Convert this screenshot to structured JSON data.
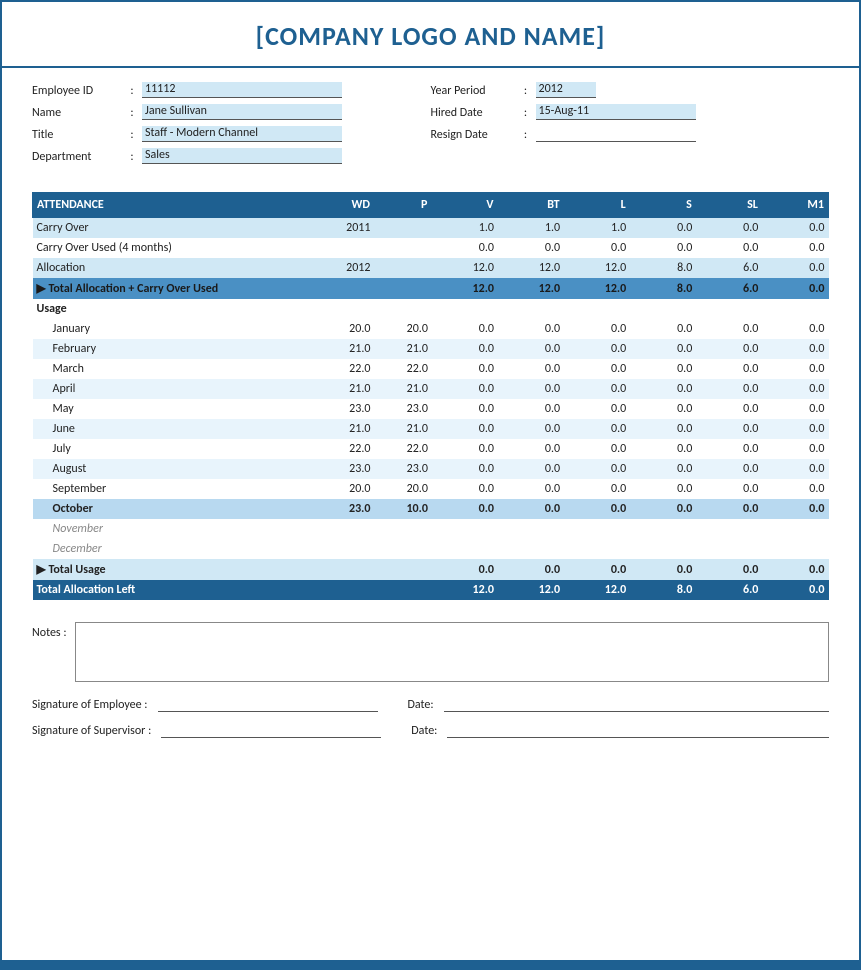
{
  "header": {
    "title": "[COMPANY LOGO AND NAME]"
  },
  "employee": {
    "id_label": "Employee ID",
    "id_colon": ":",
    "id_value": "11112",
    "name_label": "Name",
    "name_colon": ":",
    "name_value": "Jane Sullivan",
    "title_label": "Title",
    "title_colon": ":",
    "title_value": "Staff - Modern Channel",
    "dept_label": "Department",
    "dept_colon": ":",
    "dept_value": "Sales"
  },
  "period": {
    "year_label": "Year Period",
    "year_colon": ":",
    "year_value": "2012",
    "hired_label": "Hired Date",
    "hired_colon": ":",
    "hired_value": "15-Aug-11",
    "resign_label": "Resign Date",
    "resign_colon": ":"
  },
  "table": {
    "headers": [
      "ATTENDANCE",
      "WD",
      "P",
      "V",
      "BT",
      "L",
      "S",
      "SL",
      "M1"
    ],
    "rows": [
      {
        "type": "carry-over",
        "label": "Carry Over",
        "year": "2011",
        "wd": "",
        "p": "",
        "v": "1.0",
        "bt": "1.0",
        "l": "1.0",
        "s": "0.0",
        "sl": "0.0",
        "m1": "0.0"
      },
      {
        "type": "carry-over-used",
        "label": "Carry Over Used (4 months)",
        "year": "",
        "wd": "",
        "p": "",
        "v": "0.0",
        "bt": "0.0",
        "l": "0.0",
        "s": "0.0",
        "sl": "0.0",
        "m1": "0.0"
      },
      {
        "type": "allocation",
        "label": "Allocation",
        "year": "2012",
        "wd": "",
        "p": "",
        "v": "12.0",
        "bt": "12.0",
        "l": "12.0",
        "s": "8.0",
        "sl": "6.0",
        "m1": "0.0"
      },
      {
        "type": "total-alloc",
        "label": "▶ Total Allocation + Carry Over Used",
        "year": "",
        "wd": "",
        "p": "",
        "v": "12.0",
        "bt": "12.0",
        "l": "12.0",
        "s": "8.0",
        "sl": "6.0",
        "m1": "0.0"
      },
      {
        "type": "usage-header",
        "label": "Usage",
        "year": "",
        "wd": "",
        "p": "",
        "v": "",
        "bt": "",
        "l": "",
        "s": "",
        "sl": "",
        "m1": ""
      },
      {
        "type": "month-odd",
        "label": "January",
        "year": "",
        "wd": "20.0",
        "p": "20.0",
        "v": "0.0",
        "bt": "0.0",
        "l": "0.0",
        "s": "0.0",
        "sl": "0.0",
        "m1": "0.0"
      },
      {
        "type": "month-even",
        "label": "February",
        "year": "",
        "wd": "21.0",
        "p": "21.0",
        "v": "0.0",
        "bt": "0.0",
        "l": "0.0",
        "s": "0.0",
        "sl": "0.0",
        "m1": "0.0"
      },
      {
        "type": "month-odd",
        "label": "March",
        "year": "",
        "wd": "22.0",
        "p": "22.0",
        "v": "0.0",
        "bt": "0.0",
        "l": "0.0",
        "s": "0.0",
        "sl": "0.0",
        "m1": "0.0"
      },
      {
        "type": "month-even",
        "label": "April",
        "year": "",
        "wd": "21.0",
        "p": "21.0",
        "v": "0.0",
        "bt": "0.0",
        "l": "0.0",
        "s": "0.0",
        "sl": "0.0",
        "m1": "0.0"
      },
      {
        "type": "month-odd",
        "label": "May",
        "year": "",
        "wd": "23.0",
        "p": "23.0",
        "v": "0.0",
        "bt": "0.0",
        "l": "0.0",
        "s": "0.0",
        "sl": "0.0",
        "m1": "0.0"
      },
      {
        "type": "month-even",
        "label": "June",
        "year": "",
        "wd": "21.0",
        "p": "21.0",
        "v": "0.0",
        "bt": "0.0",
        "l": "0.0",
        "s": "0.0",
        "sl": "0.0",
        "m1": "0.0"
      },
      {
        "type": "month-odd",
        "label": "July",
        "year": "",
        "wd": "22.0",
        "p": "22.0",
        "v": "0.0",
        "bt": "0.0",
        "l": "0.0",
        "s": "0.0",
        "sl": "0.0",
        "m1": "0.0"
      },
      {
        "type": "month-even",
        "label": "August",
        "year": "",
        "wd": "23.0",
        "p": "23.0",
        "v": "0.0",
        "bt": "0.0",
        "l": "0.0",
        "s": "0.0",
        "sl": "0.0",
        "m1": "0.0"
      },
      {
        "type": "month-odd",
        "label": "September",
        "year": "",
        "wd": "20.0",
        "p": "20.0",
        "v": "0.0",
        "bt": "0.0",
        "l": "0.0",
        "s": "0.0",
        "sl": "0.0",
        "m1": "0.0"
      },
      {
        "type": "october",
        "label": "October",
        "year": "",
        "wd": "23.0",
        "p": "10.0",
        "v": "0.0",
        "bt": "0.0",
        "l": "0.0",
        "s": "0.0",
        "sl": "0.0",
        "m1": "0.0"
      },
      {
        "type": "future",
        "label": "November",
        "year": "",
        "wd": "",
        "p": "",
        "v": "",
        "bt": "",
        "l": "",
        "s": "",
        "sl": "",
        "m1": ""
      },
      {
        "type": "future",
        "label": "December",
        "year": "",
        "wd": "",
        "p": "",
        "v": "",
        "bt": "",
        "l": "",
        "s": "",
        "sl": "",
        "m1": ""
      },
      {
        "type": "total-usage",
        "label": "▶ Total Usage",
        "year": "",
        "wd": "",
        "p": "",
        "v": "0.0",
        "bt": "0.0",
        "l": "0.0",
        "s": "0.0",
        "sl": "0.0",
        "m1": "0.0"
      },
      {
        "type": "alloc-left",
        "label": "Total Allocation Left",
        "year": "",
        "wd": "",
        "p": "",
        "v": "12.0",
        "bt": "12.0",
        "l": "12.0",
        "s": "8.0",
        "sl": "6.0",
        "m1": "0.0"
      }
    ]
  },
  "notes": {
    "label": "Notes :"
  },
  "signatures": {
    "emp_label": "Signature of Employee :",
    "sup_label": "Signature of Supervisor :",
    "date_label": "Date:"
  }
}
